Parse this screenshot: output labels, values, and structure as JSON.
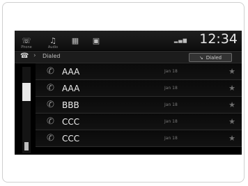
{
  "statusbar": {
    "icons": [
      "phone-icon",
      "audio-icon",
      "grid-icon",
      "grid-icon"
    ],
    "phone_caption": "Phone",
    "audio_caption": "Audio",
    "clock": "12:34"
  },
  "header": {
    "title": "Dialed",
    "button_label": "Dialed"
  },
  "calls": [
    {
      "name": "AAA",
      "date": "Jan 18"
    },
    {
      "name": "AAA",
      "date": "Jan 18"
    },
    {
      "name": "BBB",
      "date": "Jan 18"
    },
    {
      "name": "CCC",
      "date": "Jan 18"
    },
    {
      "name": "CCC",
      "date": "Jan 18"
    }
  ],
  "colors": {
    "screen_bg": "#000000",
    "text": "#f0f0f0",
    "muted": "#7a7a7a"
  }
}
